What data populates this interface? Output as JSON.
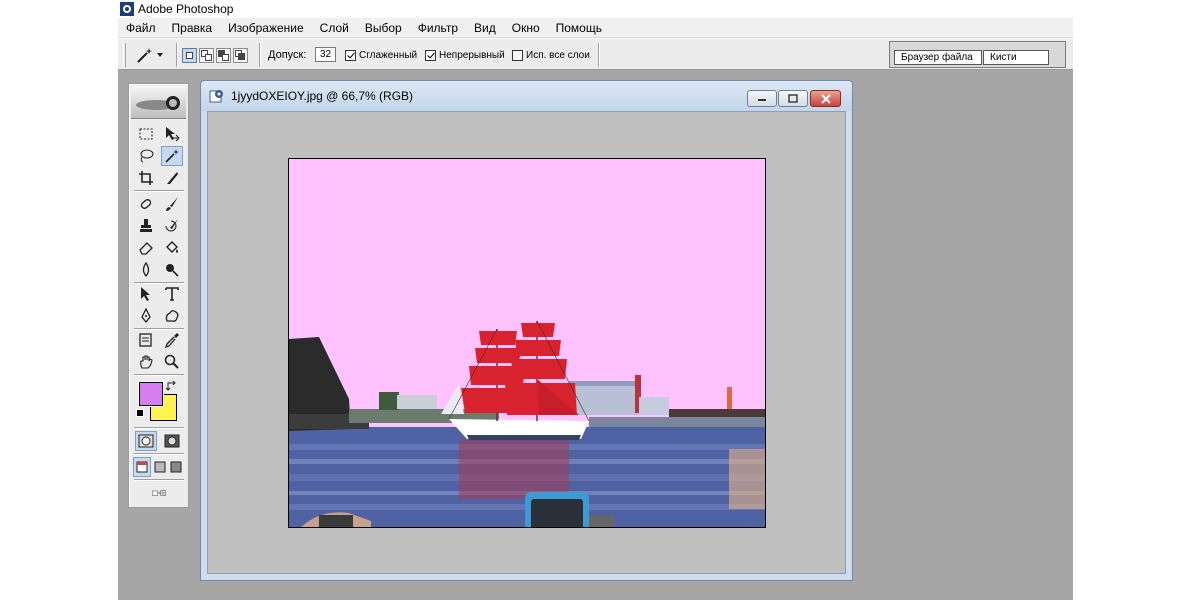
{
  "app": {
    "title": "Adobe Photoshop"
  },
  "menu": [
    "Файл",
    "Правка",
    "Изображение",
    "Слой",
    "Выбор",
    "Фильтр",
    "Вид",
    "Окно",
    "Помощь"
  ],
  "options": {
    "tolerance_label": "Допуск:",
    "tolerance_value": "32",
    "anti_alias_label": "Сглаженный",
    "anti_alias_checked": true,
    "contiguous_label": "Непрерывный",
    "contiguous_checked": true,
    "all_layers_label": "Исп. все слои",
    "all_layers_checked": false
  },
  "palette_well": {
    "tabs": [
      "Браузер файла",
      "Кисти"
    ]
  },
  "toolbox": {
    "foreground_color": "#d97ef0",
    "background_color": "#fff34f",
    "active_tool": "magic-wand"
  },
  "document": {
    "title": "1jyydOXEIOY.jpg @ 66,7% (RGB)",
    "sky_color": "#fec3fe",
    "water_color": "#4d5fa0",
    "sail_color": "#d8232f"
  }
}
